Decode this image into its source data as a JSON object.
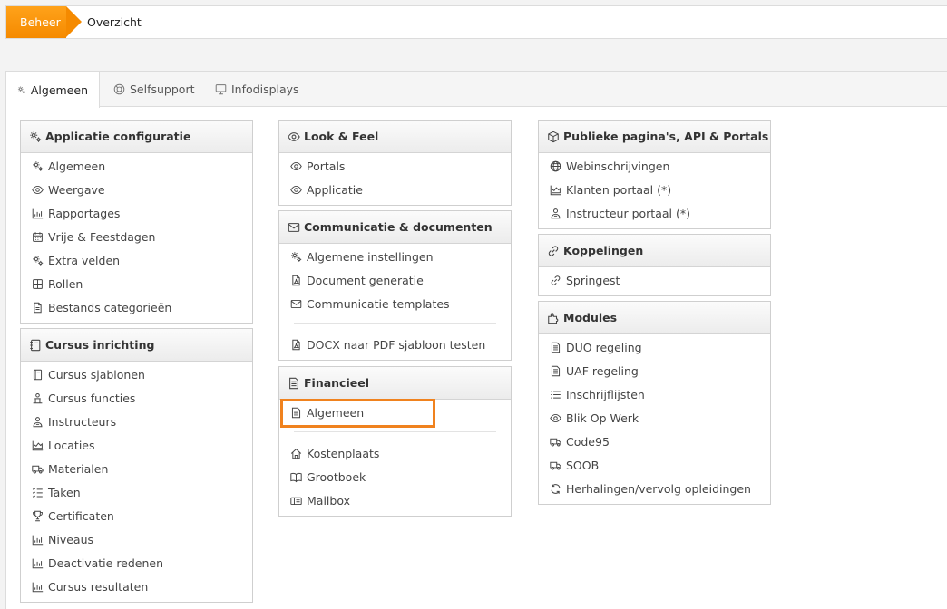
{
  "breadcrumb": {
    "home": "Beheer",
    "current": "Overzicht"
  },
  "tabs": [
    {
      "label": "Algemeen",
      "icon": "gears-icon",
      "active": true
    },
    {
      "label": "Selfsupport",
      "icon": "lifebuoy-icon",
      "active": false
    },
    {
      "label": "Infodisplays",
      "icon": "monitor-icon",
      "active": false
    }
  ],
  "cards": {
    "app_config": {
      "title": "Applicatie configuratie",
      "items": [
        "Algemeen",
        "Weergave",
        "Rapportages",
        "Vrije & Feestdagen",
        "Extra velden",
        "Rollen",
        "Bestands categorieën"
      ]
    },
    "course": {
      "title": "Cursus inrichting",
      "items": [
        "Cursus sjablonen",
        "Cursus functies",
        "Instructeurs",
        "Locaties",
        "Materialen",
        "Taken",
        "Certificaten",
        "Niveaus",
        "Deactivatie redenen",
        "Cursus resultaten"
      ]
    },
    "look": {
      "title": "Look & Feel",
      "items": [
        "Portals",
        "Applicatie"
      ]
    },
    "comm": {
      "title": "Communicatie & documenten",
      "items": [
        "Algemene instellingen",
        "Document generatie",
        "Communicatie templates",
        "DOCX naar PDF sjabloon testen"
      ]
    },
    "fin": {
      "title": "Financieel",
      "items": [
        "Algemeen",
        "Kostenplaats",
        "Grootboek",
        "Mailbox"
      ]
    },
    "public": {
      "title": "Publieke pagina's, API & Portals",
      "items": [
        "Webinschrijvingen",
        "Klanten portaal (*)",
        "Instructeur portaal (*)"
      ]
    },
    "links": {
      "title": "Koppelingen",
      "items": [
        "Springest"
      ]
    },
    "modules": {
      "title": "Modules",
      "items": [
        "DUO regeling",
        "UAF regeling",
        "Inschrijflijsten",
        "Blik Op Werk",
        "Code95",
        "SOOB",
        "Herhalingen/vervolg opleidingen"
      ]
    }
  },
  "colors": {
    "accent": "#f58a00",
    "highlight": "#f0821e",
    "icon": "#9a9a9a"
  }
}
